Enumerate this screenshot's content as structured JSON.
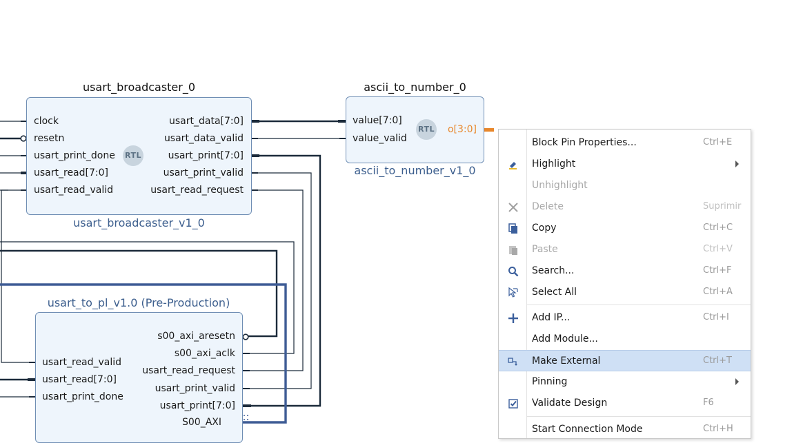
{
  "diagram": {
    "blocks": {
      "broadcaster": {
        "instance_name": "usart_broadcaster_0",
        "module_name": "usart_broadcaster_v1_0",
        "badge": "RTL",
        "left_ports": [
          "clock",
          "resetn",
          "usart_print_done",
          "usart_read[7:0]",
          "usart_read_valid"
        ],
        "right_ports": [
          "usart_data[7:0]",
          "usart_data_valid",
          "usart_print[7:0]",
          "usart_print_valid",
          "usart_read_request"
        ]
      },
      "ascii": {
        "instance_name": "ascii_to_number_0",
        "module_name": "ascii_to_number_v1_0",
        "badge": "RTL",
        "left_ports": [
          "value[7:0]",
          "value_valid"
        ],
        "output_port": "o[3:0]",
        "output_color": "#e8872b"
      },
      "usart_to_pl": {
        "title": "usart_to_pl_v1.0 (Pre-Production)",
        "left_ports": [
          "usart_read_valid",
          "usart_read[7:0]",
          "usart_print_done"
        ],
        "right_ports": [
          "s00_axi_aresetn",
          "s00_axi_aclk",
          "usart_read_request",
          "usart_print_valid",
          "usart_print[7:0]",
          "S00_AXI"
        ]
      }
    },
    "colors": {
      "block_fill": "#eef5fc",
      "block_border": "#6f8eb4",
      "wire": "#1b2a3a",
      "bus_wire": "#3e5c95",
      "selected_menu_bg": "#cfe0f5"
    }
  },
  "context_menu": {
    "items": [
      {
        "label": "Block Pin Properties...",
        "shortcut": "Ctrl+E",
        "icon": "",
        "enabled": true
      },
      {
        "label": "Highlight",
        "shortcut": "",
        "icon": "highlight-marker-icon",
        "enabled": true,
        "submenu": true
      },
      {
        "label": "Unhighlight",
        "shortcut": "",
        "icon": "",
        "enabled": false
      },
      {
        "label": "Delete",
        "shortcut": "Suprimir",
        "icon": "delete-x-icon",
        "enabled": false
      },
      {
        "label": "Copy",
        "shortcut": "Ctrl+C",
        "icon": "copy-icon",
        "enabled": true
      },
      {
        "label": "Paste",
        "shortcut": "Ctrl+V",
        "icon": "paste-icon",
        "enabled": false
      },
      {
        "label": "Search...",
        "shortcut": "Ctrl+F",
        "icon": "search-icon",
        "enabled": true
      },
      {
        "label": "Select All",
        "shortcut": "Ctrl+A",
        "icon": "select-all-cursor-icon",
        "enabled": true
      },
      {
        "label": "Add IP...",
        "shortcut": "Ctrl+I",
        "icon": "plus-icon",
        "enabled": true
      },
      {
        "label": "Add Module...",
        "shortcut": "",
        "icon": "",
        "enabled": true
      },
      {
        "label": "Make External",
        "shortcut": "Ctrl+T",
        "icon": "make-external-icon",
        "enabled": true,
        "selected": true
      },
      {
        "label": "Pinning",
        "shortcut": "",
        "icon": "",
        "enabled": true,
        "submenu": true
      },
      {
        "label": "Validate Design",
        "shortcut": "F6",
        "icon": "validate-checkbox-icon",
        "enabled": true
      },
      {
        "label": "Start Connection Mode",
        "shortcut": "Ctrl+H",
        "icon": "",
        "enabled": true
      }
    ]
  }
}
